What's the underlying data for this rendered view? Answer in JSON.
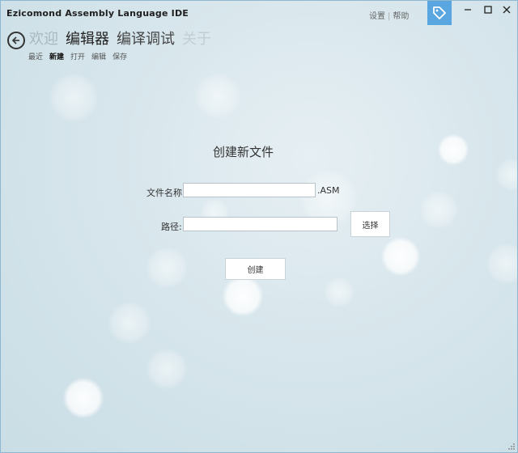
{
  "app_title": "Ezicomond Assembly Language IDE",
  "top_links": {
    "settings": "设置",
    "separator": "|",
    "help": "帮助"
  },
  "nav": {
    "main": [
      "欢迎",
      "编辑器",
      "编译调试",
      "关于"
    ],
    "sub": [
      "最近",
      "新建",
      "打开",
      "编辑",
      "保存"
    ]
  },
  "form": {
    "title": "创建新文件",
    "filename_label": "文件名称:",
    "filename_value": "",
    "extension": ".ASM",
    "path_label": "路径:",
    "path_value": "",
    "browse_button": "选择",
    "create_button": "创建"
  },
  "colors": {
    "accent": "#5aa6e1",
    "border": "#8fb7cf"
  }
}
